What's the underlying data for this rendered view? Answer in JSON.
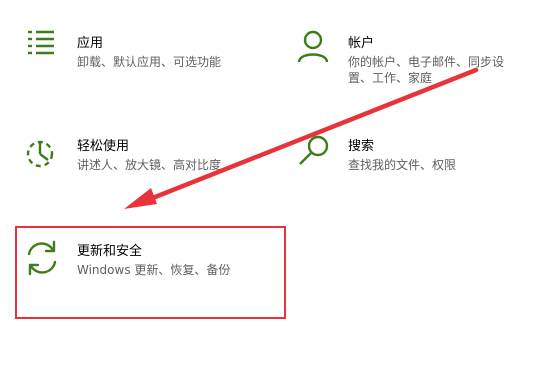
{
  "colors": {
    "icon_green": "#3f7d1a",
    "annotation_red": "#e8333a",
    "title_text": "#000000",
    "desc_text": "#5f5f5f"
  },
  "tiles": [
    {
      "id": "apps",
      "icon": "apps-list-icon",
      "title": "应用",
      "desc": "卸载、默认应用、可选功能"
    },
    {
      "id": "accounts",
      "icon": "person-icon",
      "title": "帐户",
      "desc": "你的帐户、电子邮件、同步设置、工作、家庭"
    },
    {
      "id": "ease_of_access",
      "icon": "ease-of-access-icon",
      "title": "轻松使用",
      "desc": "讲述人、放大镜、高对比度"
    },
    {
      "id": "search",
      "icon": "search-icon",
      "title": "搜索",
      "desc": "查找我的文件、权限"
    },
    {
      "id": "update_security",
      "icon": "sync-icon",
      "title": "更新和安全",
      "desc": "Windows 更新、恢复、备份"
    }
  ],
  "annotation": {
    "highlight": "update_security",
    "arrow": "red-arrow"
  }
}
